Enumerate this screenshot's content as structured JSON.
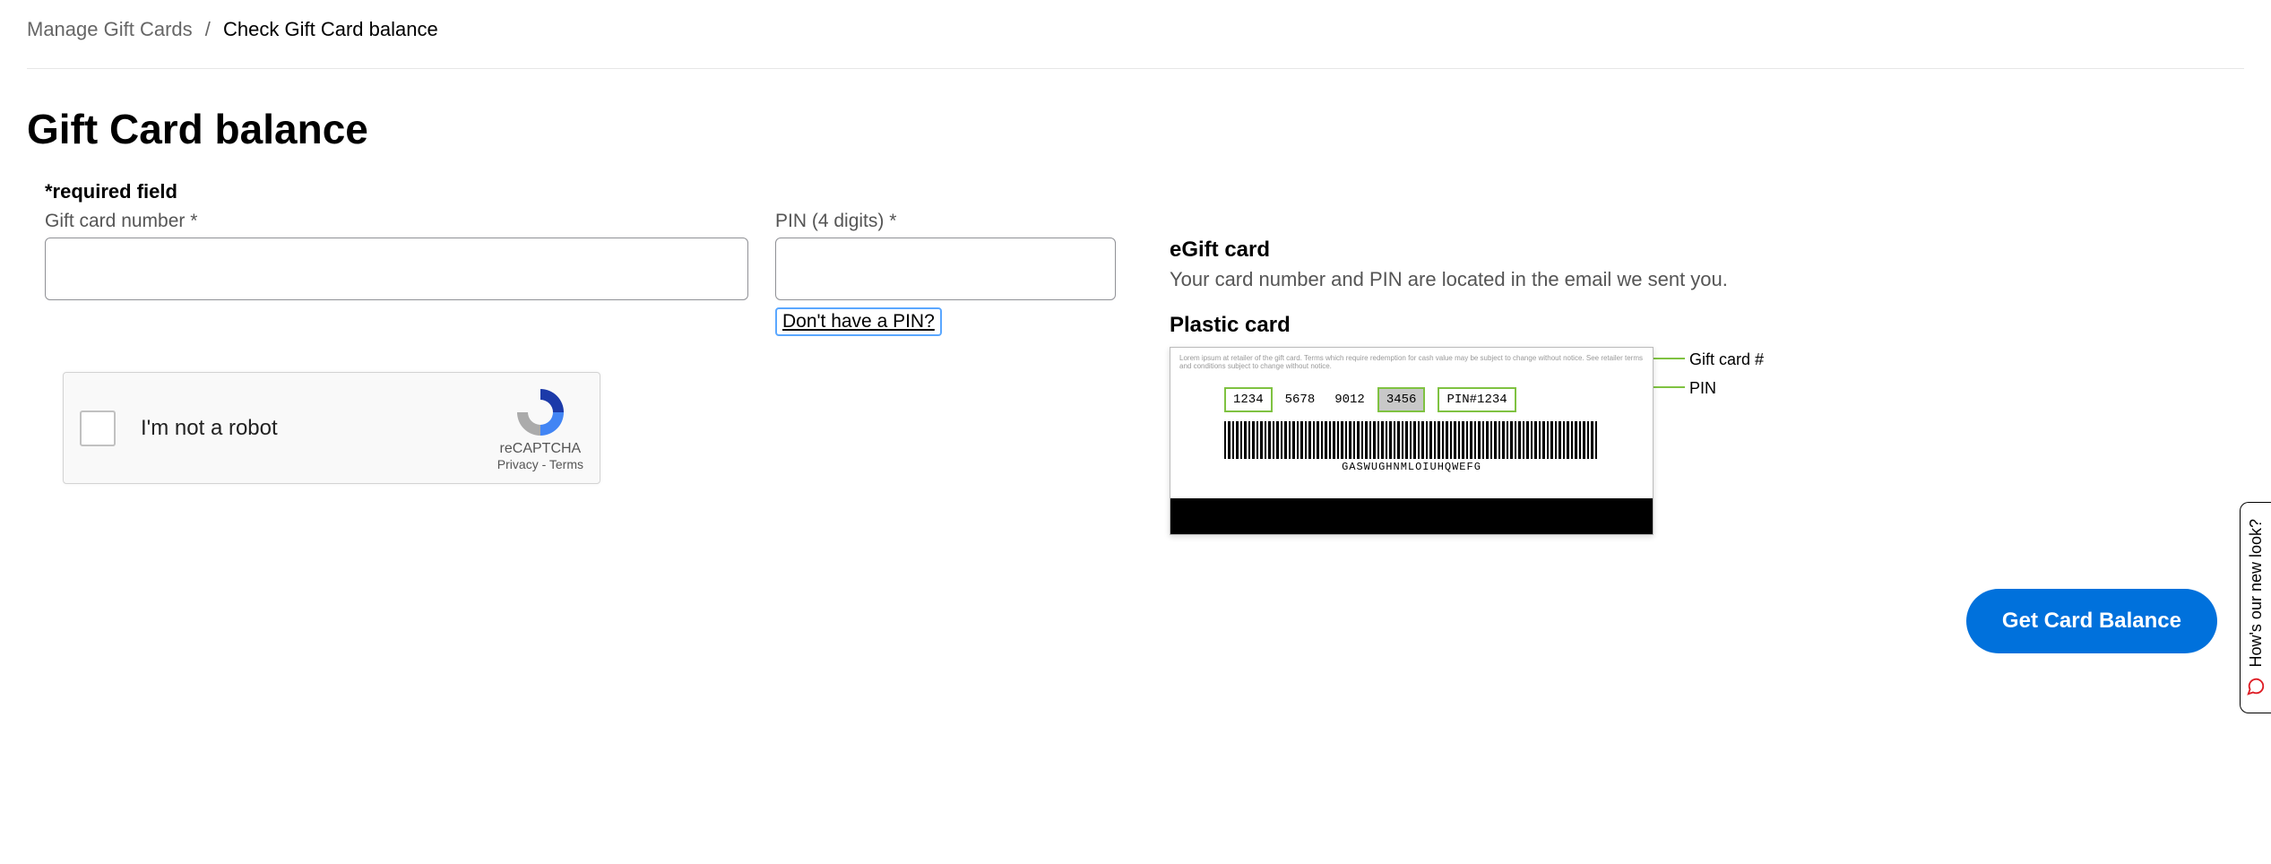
{
  "breadcrumb": {
    "parent": "Manage Gift Cards",
    "separator": "/",
    "current": "Check Gift Card balance"
  },
  "page_title": "Gift Card balance",
  "required_note": "*required field",
  "fields": {
    "card_number": {
      "label": "Gift card number *",
      "value": ""
    },
    "pin": {
      "label": "PIN (4 digits) *",
      "value": "",
      "help_link": "Don't have a PIN?"
    }
  },
  "captcha": {
    "label": "I'm not a robot",
    "brand": "reCAPTCHA",
    "links": "Privacy - Terms"
  },
  "info": {
    "egift_heading": "eGift card",
    "egift_body": "Your card number and PIN are located in the email we sent you.",
    "plastic_heading": "Plastic card",
    "diagram": {
      "segments": [
        "1234",
        "5678",
        "9012",
        "3456"
      ],
      "pin_box": "PIN#1234",
      "barcode_text": "GASWUGHNMLOIUHQWEFG",
      "callout_giftnum": "Gift card #",
      "callout_pin": "PIN"
    }
  },
  "cta_label": "Get Card Balance",
  "feedback_tab": "How's our new look?"
}
